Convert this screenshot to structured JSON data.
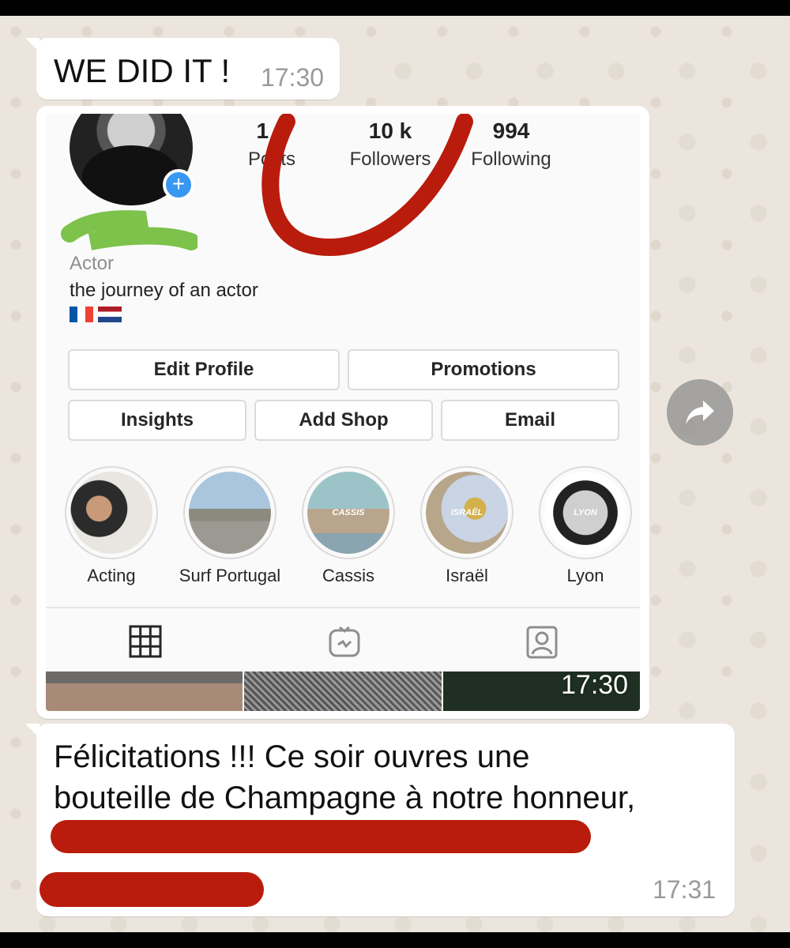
{
  "messages": {
    "first": {
      "text": "WE DID IT !",
      "time": "17:30"
    },
    "screenshot": {
      "time": "17:30",
      "profile": {
        "stats": [
          {
            "num": "1 3",
            "label": "Posts"
          },
          {
            "num": "10 k",
            "label": "Followers"
          },
          {
            "num": "994",
            "label": "Following"
          }
        ],
        "role": "Actor",
        "bio": "the journey of an actor"
      },
      "buttons": {
        "edit_profile": "Edit Profile",
        "promotions": "Promotions",
        "insights": "Insights",
        "add_shop": "Add Shop",
        "email": "Email"
      },
      "highlights": [
        {
          "name": "Acting",
          "overlay": ""
        },
        {
          "name": "Surf Portugal",
          "overlay": ""
        },
        {
          "name": "Cassis",
          "overlay": "CASSIS"
        },
        {
          "name": "Israël",
          "overlay": "ISRAËL"
        },
        {
          "name": "Lyon",
          "overlay": "LYON"
        }
      ],
      "tabs": [
        "grid-icon",
        "igtv-icon",
        "tagged-icon"
      ]
    },
    "reply": {
      "text_line1": "Félicitations !!! Ce soir ouvres une",
      "text_line2": "bouteille de Champagne à notre honneur,",
      "time": "17:31"
    }
  },
  "colors": {
    "accent_blue": "#3897f0",
    "redaction_red": "#b91c0c",
    "highlight_green": "#7dc24b",
    "chat_background": "#ece5dd"
  }
}
